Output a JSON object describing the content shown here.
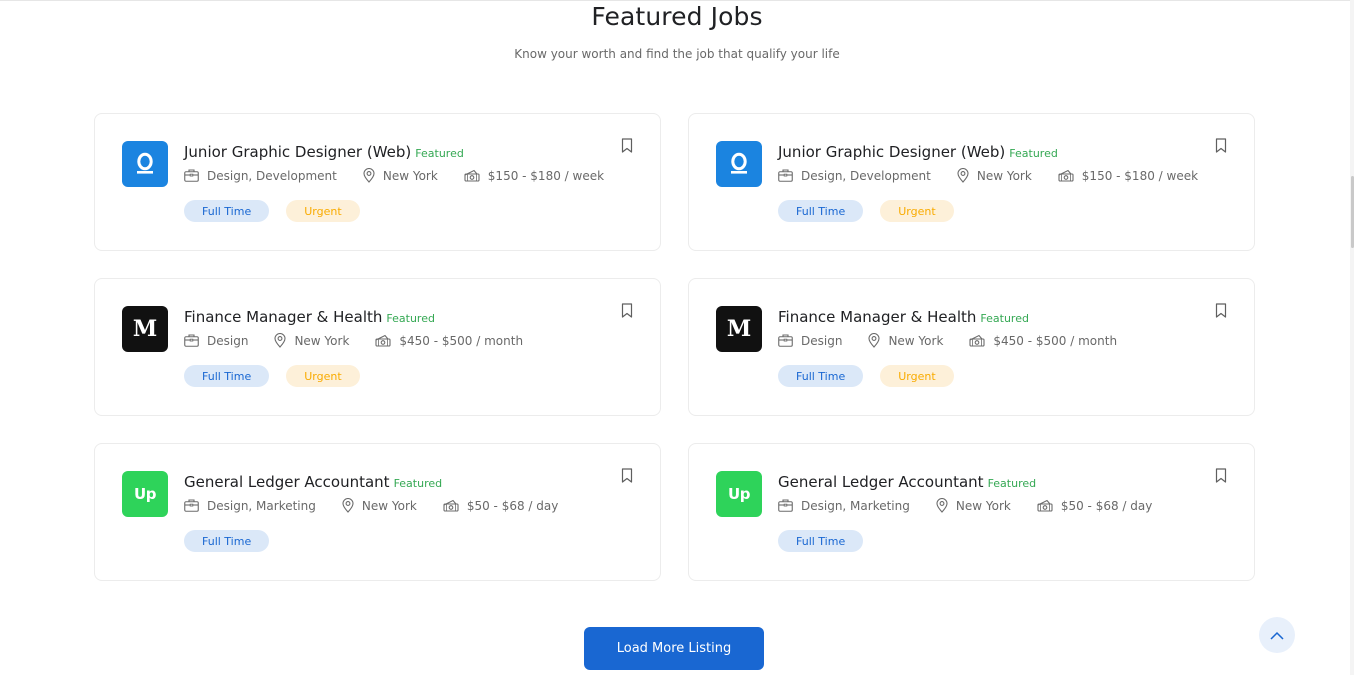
{
  "section": {
    "title": "Featured Jobs",
    "subtitle": "Know your worth and find the job that qualify your life"
  },
  "jobs": [
    {
      "logo": "Q",
      "logo_color": "#1b84e0",
      "title": "Junior Graphic Designer (Web)",
      "featured": "Featured",
      "category": "Design, Development",
      "location": "New York",
      "salary": "$150 - $180 / week",
      "tags": [
        "Full Time",
        "Urgent"
      ]
    },
    {
      "logo": "Q",
      "logo_color": "#1b84e0",
      "title": "Junior Graphic Designer (Web)",
      "featured": "Featured",
      "category": "Design, Development",
      "location": "New York",
      "salary": "$150 - $180 / week",
      "tags": [
        "Full Time",
        "Urgent"
      ]
    },
    {
      "logo": "M",
      "logo_color": "#111111",
      "title": "Finance Manager & Health",
      "featured": "Featured",
      "category": "Design",
      "location": "New York",
      "salary": "$450 - $500 / month",
      "tags": [
        "Full Time",
        "Urgent"
      ]
    },
    {
      "logo": "M",
      "logo_color": "#111111",
      "title": "Finance Manager & Health",
      "featured": "Featured",
      "category": "Design",
      "location": "New York",
      "salary": "$450 - $500 / month",
      "tags": [
        "Full Time",
        "Urgent"
      ]
    },
    {
      "logo": "Up",
      "logo_color": "#2ed35a",
      "title": "General Ledger Accountant",
      "featured": "Featured",
      "category": "Design, Marketing",
      "location": "New York",
      "salary": "$50 - $68 / day",
      "tags": [
        "Full Time"
      ]
    },
    {
      "logo": "Up",
      "logo_color": "#2ed35a",
      "title": "General Ledger Accountant",
      "featured": "Featured",
      "category": "Design, Marketing",
      "location": "New York",
      "salary": "$50 - $68 / day",
      "tags": [
        "Full Time"
      ]
    }
  ],
  "load_more_label": "Load More Listing",
  "icons": {
    "category": "briefcase-icon",
    "location": "map-pin-icon",
    "salary": "money-icon",
    "bookmark": "bookmark-icon",
    "to_top": "chevron-up-icon"
  }
}
